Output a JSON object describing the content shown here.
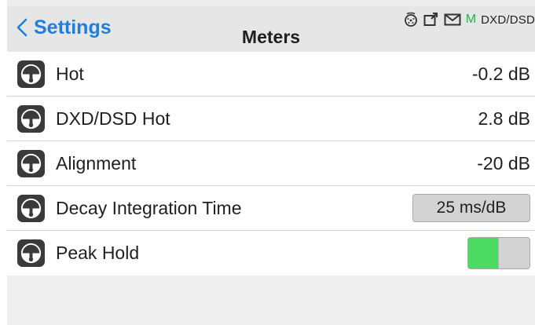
{
  "header": {
    "back_label": "Settings",
    "title": "Meters",
    "status": {
      "m_letter": "M",
      "mode": "DXD/DSD",
      "icons": [
        "dial-icon",
        "input-icon",
        "mail-icon"
      ],
      "m_color": "#27b24a"
    }
  },
  "rows": [
    {
      "label": "Hot",
      "value": "-0.2 dB",
      "icon": "meter-icon"
    },
    {
      "label": "DXD/DSD Hot",
      "value": "2.8 dB",
      "icon": "meter-icon"
    },
    {
      "label": "Alignment",
      "value": "-20 dB",
      "icon": "meter-icon"
    },
    {
      "label": "Decay Integration Time",
      "value": "25 ms/dB",
      "icon": "meter-icon"
    },
    {
      "label": "Peak Hold",
      "toggle_on": true,
      "icon": "meter-icon"
    }
  ],
  "colors": {
    "accent": "#1e7fe0",
    "toggle_on": "#4cd964"
  }
}
